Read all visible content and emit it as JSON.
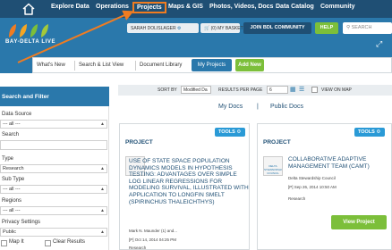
{
  "topnav": {
    "items": [
      {
        "label": "Explore Data"
      },
      {
        "label": "Operations"
      },
      {
        "label": "Projects"
      },
      {
        "label": "Maps & GIS"
      },
      {
        "label": "Photos, Videos, Docs"
      },
      {
        "label": "Data Catalog"
      },
      {
        "label": "Community"
      }
    ],
    "home_icon": "home-icon",
    "highlight_color": "#f07c21"
  },
  "header": {
    "logo_text": "BAY-DELTA LIVE",
    "user_label": "SARAH DOLISLAGER",
    "basket_label": "(0) MY BASKET",
    "join_label": "JOIN BDL COMMUNITY",
    "help_label": "HELP",
    "search_placeholder": "SEARCH"
  },
  "subnav": {
    "whats_new": "What's New",
    "search_list": "Search & List View",
    "doc_library": "Document Library",
    "my_projects": "My Projects",
    "add_new": "Add New"
  },
  "sidebar": {
    "title": "Search and Filter",
    "data_source_label": "Data Source",
    "data_source_value": "--- all ---",
    "search_label": "Search",
    "type_label": "Type",
    "type_value": "Research",
    "subtype_label": "Sub Type",
    "subtype_value": "--- all ---",
    "regions_label": "Regions",
    "regions_value": "--- all ---",
    "privacy_label": "Privacy Settings",
    "privacy_value": "Public",
    "map_it_label": "Map It",
    "clear_results_label": "Clear Results"
  },
  "sortbar": {
    "sort_by_label": "SORT BY",
    "sort_by_value": "Modified Da",
    "results_label": "RESULTS PER PAGE",
    "results_value": "6",
    "view_on_map_label": "VIEW ON MAP"
  },
  "tabs": {
    "my_docs": "My Docs",
    "separator": "|",
    "public_docs": "Public Docs"
  },
  "cards": [
    {
      "tools_label": "TOOLS",
      "type": "PROJECT",
      "title": "USE OF STATE SPACE POPULATION DYNAMICS MODELS IN HYPOTHESIS TESTING: ADVANTAGES OVER SIMPLE LOG LINEAR REGRESSIONS FOR MODELING SURVIVAL, ILLUSTRATED WITH APPLICATION TO LONGFIN SMELT (SPIRINCHUS THALEICHTHYS)",
      "author": "Mark N. Maunder (1) and...",
      "date": "[P] Oct 14, 2014 04:25 PM",
      "category": "Research"
    },
    {
      "tools_label": "TOOLS",
      "type": "PROJECT",
      "thumb_text": "DELTA STEWARDSHIP COUNCIL",
      "title": "COLLABORATIVE ADAPTIVE MANAGEMENT TEAM (CAMT)",
      "author": "Delta Stewardship Council",
      "date": "[P] Sep 26, 2014 10:50 AM",
      "category": "Research",
      "view_label": "View Project"
    }
  ]
}
